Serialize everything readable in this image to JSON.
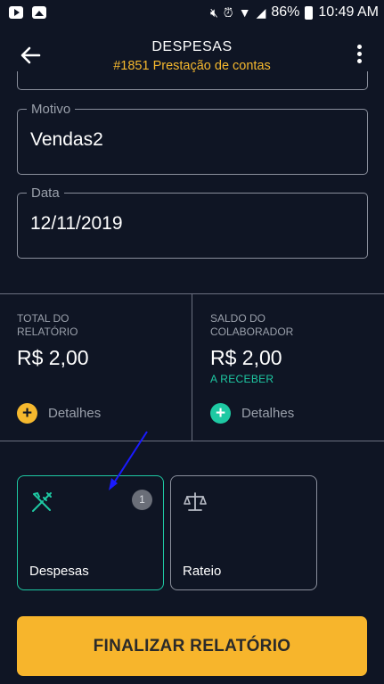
{
  "status_bar": {
    "battery": "86%",
    "time": "10:49 AM"
  },
  "header": {
    "title": "DESPESAS",
    "subtitle": "#1851 Prestação de contas"
  },
  "form": {
    "motivo": {
      "label": "Motivo",
      "value": "Vendas2"
    },
    "data": {
      "label": "Data",
      "value": "12/11/2019"
    }
  },
  "summary": {
    "total": {
      "label": "TOTAL DO RELATÓRIO",
      "value": "R$ 2,00",
      "details": "Detalhes"
    },
    "saldo": {
      "label": "SALDO DO COLABORADOR",
      "value": "R$ 2,00",
      "status": "A RECEBER",
      "details": "Detalhes"
    }
  },
  "cards": {
    "despesas": {
      "label": "Despesas",
      "badge": "1",
      "icon": "fork-knife-icon"
    },
    "rateio": {
      "label": "Rateio",
      "icon": "scale-icon"
    }
  },
  "finalize_label": "FINALIZAR RELATÓRIO",
  "colors": {
    "background": "#0f1524",
    "accent_yellow": "#f5b82e",
    "accent_teal": "#1ec9a3",
    "annotation_arrow": "#1a1aff"
  }
}
